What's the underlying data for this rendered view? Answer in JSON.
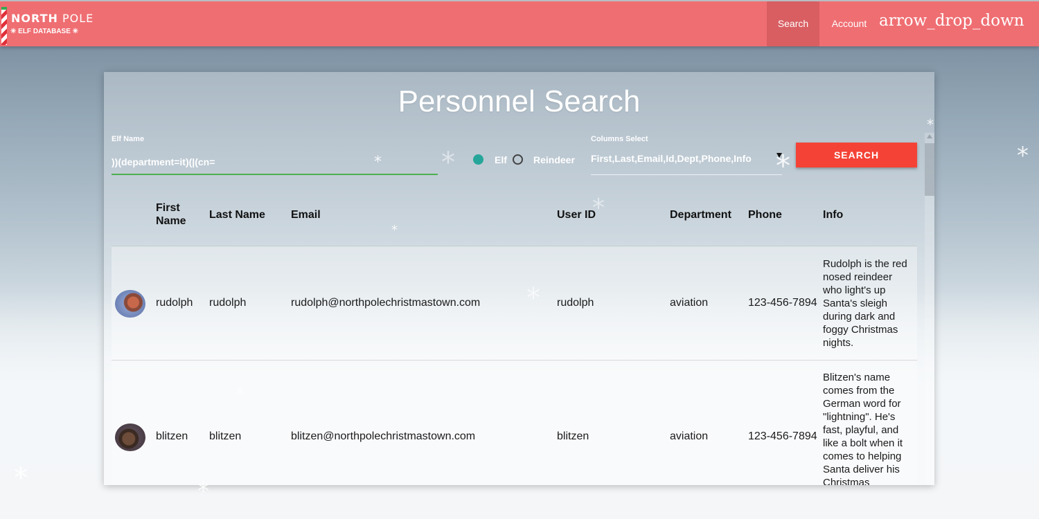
{
  "header": {
    "logo": {
      "line1_bold": "NORTH",
      "line1_rest": "POLE",
      "line2": "✳ ELF DATABASE ✳"
    },
    "nav": {
      "search": "Search",
      "account": "Account",
      "dropdown_icon": "arrow_drop_down"
    }
  },
  "panel": {
    "title": "Personnel Search",
    "name_field": {
      "label": "Elf Name",
      "value": "))(department=it)(|(cn="
    },
    "radio": {
      "elf_label": "Elf",
      "reindeer_label": "Reindeer",
      "selected": "Elf"
    },
    "columns_select": {
      "label": "Columns Select",
      "value": "First,Last,Email,Id,Dept,Phone,Info"
    },
    "search_button": "SEARCH"
  },
  "table": {
    "headers": {
      "first_line1": "First",
      "first_line2": "Name",
      "last": "Last Name",
      "email": "Email",
      "userid": "User ID",
      "department": "Department",
      "phone": "Phone",
      "info": "Info"
    },
    "rows": [
      {
        "avatar": "rudolph-avatar",
        "first": "rudolph",
        "last": "rudolph",
        "email": "rudolph@northpolechristmastown.com",
        "userid": "rudolph",
        "department": "aviation",
        "phone": "123-456-7894",
        "info_lines": [
          "Rudolph is the red",
          "nosed reindeer",
          "who light's up",
          "Santa's sleigh",
          "during dark and",
          "foggy Christmas",
          "nights."
        ]
      },
      {
        "avatar": "blitzen-avatar",
        "first": "blitzen",
        "last": "blitzen",
        "email": "blitzen@northpolechristmastown.com",
        "userid": "blitzen",
        "department": "aviation",
        "phone": "123-456-7894",
        "info_lines": [
          "Blitzen's name",
          "comes from the",
          "German word for",
          "\"lightning\". He's",
          "fast, playful, and",
          "like a bolt when it",
          "comes to helping",
          "Santa deliver his",
          "Christmas"
        ]
      }
    ]
  },
  "colors": {
    "navbar": "#ef6e72",
    "nav_active": "#d85e62",
    "accent_green": "#4caf50",
    "radio_teal": "#26a69a",
    "button_red": "#f44336"
  }
}
